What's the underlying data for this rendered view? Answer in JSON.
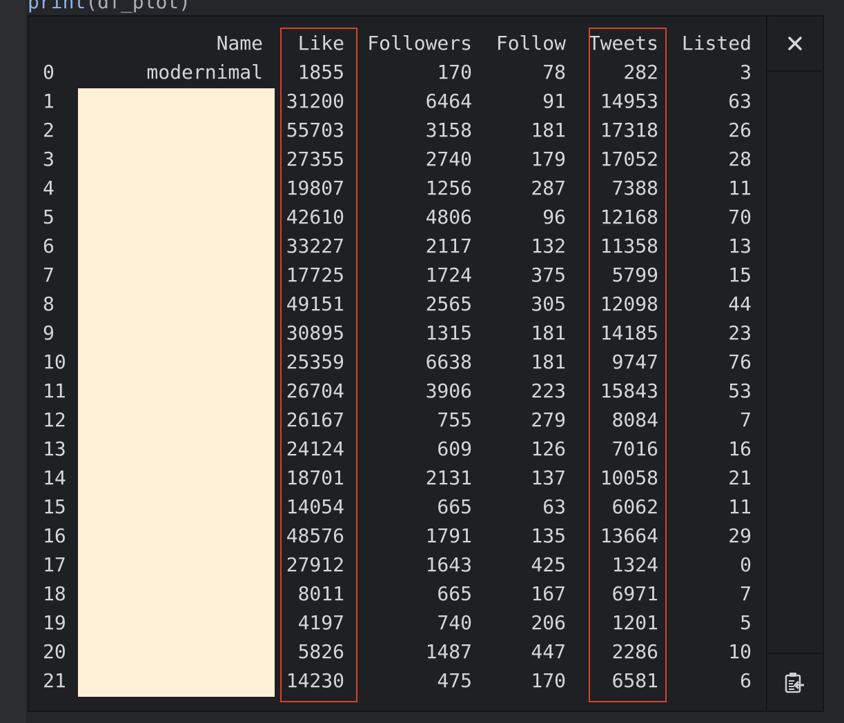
{
  "code_line": {
    "fn": "print",
    "arg": "df_plot"
  },
  "table": {
    "columns": [
      "Name",
      "Like",
      "Followers",
      "Follow",
      "Tweets",
      "Listed"
    ],
    "rows": [
      [
        "0",
        "modernimal",
        "1855",
        "170",
        "78",
        "282",
        "3"
      ],
      [
        "1",
        "",
        "31200",
        "6464",
        "91",
        "14953",
        "63"
      ],
      [
        "2",
        "",
        "55703",
        "3158",
        "181",
        "17318",
        "26"
      ],
      [
        "3",
        "",
        "27355",
        "2740",
        "179",
        "17052",
        "28"
      ],
      [
        "4",
        "",
        "19807",
        "1256",
        "287",
        "7388",
        "11"
      ],
      [
        "5",
        "",
        "42610",
        "4806",
        "96",
        "12168",
        "70"
      ],
      [
        "6",
        "",
        "33227",
        "2117",
        "132",
        "11358",
        "13"
      ],
      [
        "7",
        "",
        "17725",
        "1724",
        "375",
        "5799",
        "15"
      ],
      [
        "8",
        "",
        "49151",
        "2565",
        "305",
        "12098",
        "44"
      ],
      [
        "9",
        "",
        "30895",
        "1315",
        "181",
        "14185",
        "23"
      ],
      [
        "10",
        "",
        "25359",
        "6638",
        "181",
        "9747",
        "76"
      ],
      [
        "11",
        "",
        "26704",
        "3906",
        "223",
        "15843",
        "53"
      ],
      [
        "12",
        "",
        "26167",
        "755",
        "279",
        "8084",
        "7"
      ],
      [
        "13",
        "",
        "24124",
        "609",
        "126",
        "7016",
        "16"
      ],
      [
        "14",
        "",
        "18701",
        "2131",
        "137",
        "10058",
        "21"
      ],
      [
        "15",
        "",
        "14054",
        "665",
        "63",
        "6062",
        "11"
      ],
      [
        "16",
        "",
        "48576",
        "1791",
        "135",
        "13664",
        "29"
      ],
      [
        "17",
        "",
        "27912",
        "1643",
        "425",
        "1324",
        "0"
      ],
      [
        "18",
        "",
        "8011",
        "665",
        "167",
        "6971",
        "7"
      ],
      [
        "19",
        "",
        "4197",
        "740",
        "206",
        "1201",
        "5"
      ],
      [
        "20",
        "",
        "5826",
        "1487",
        "447",
        "2286",
        "10"
      ],
      [
        "21",
        "",
        "14230",
        "475",
        "170",
        "6581",
        "6"
      ]
    ],
    "highlighted_columns": [
      "Like",
      "Tweets"
    ],
    "highlight_color": "#d4442c",
    "redaction_color": "#fff0d8"
  },
  "side_buttons": {
    "close_icon": "close-icon",
    "paste_icon": "clipboard-paste-icon"
  }
}
